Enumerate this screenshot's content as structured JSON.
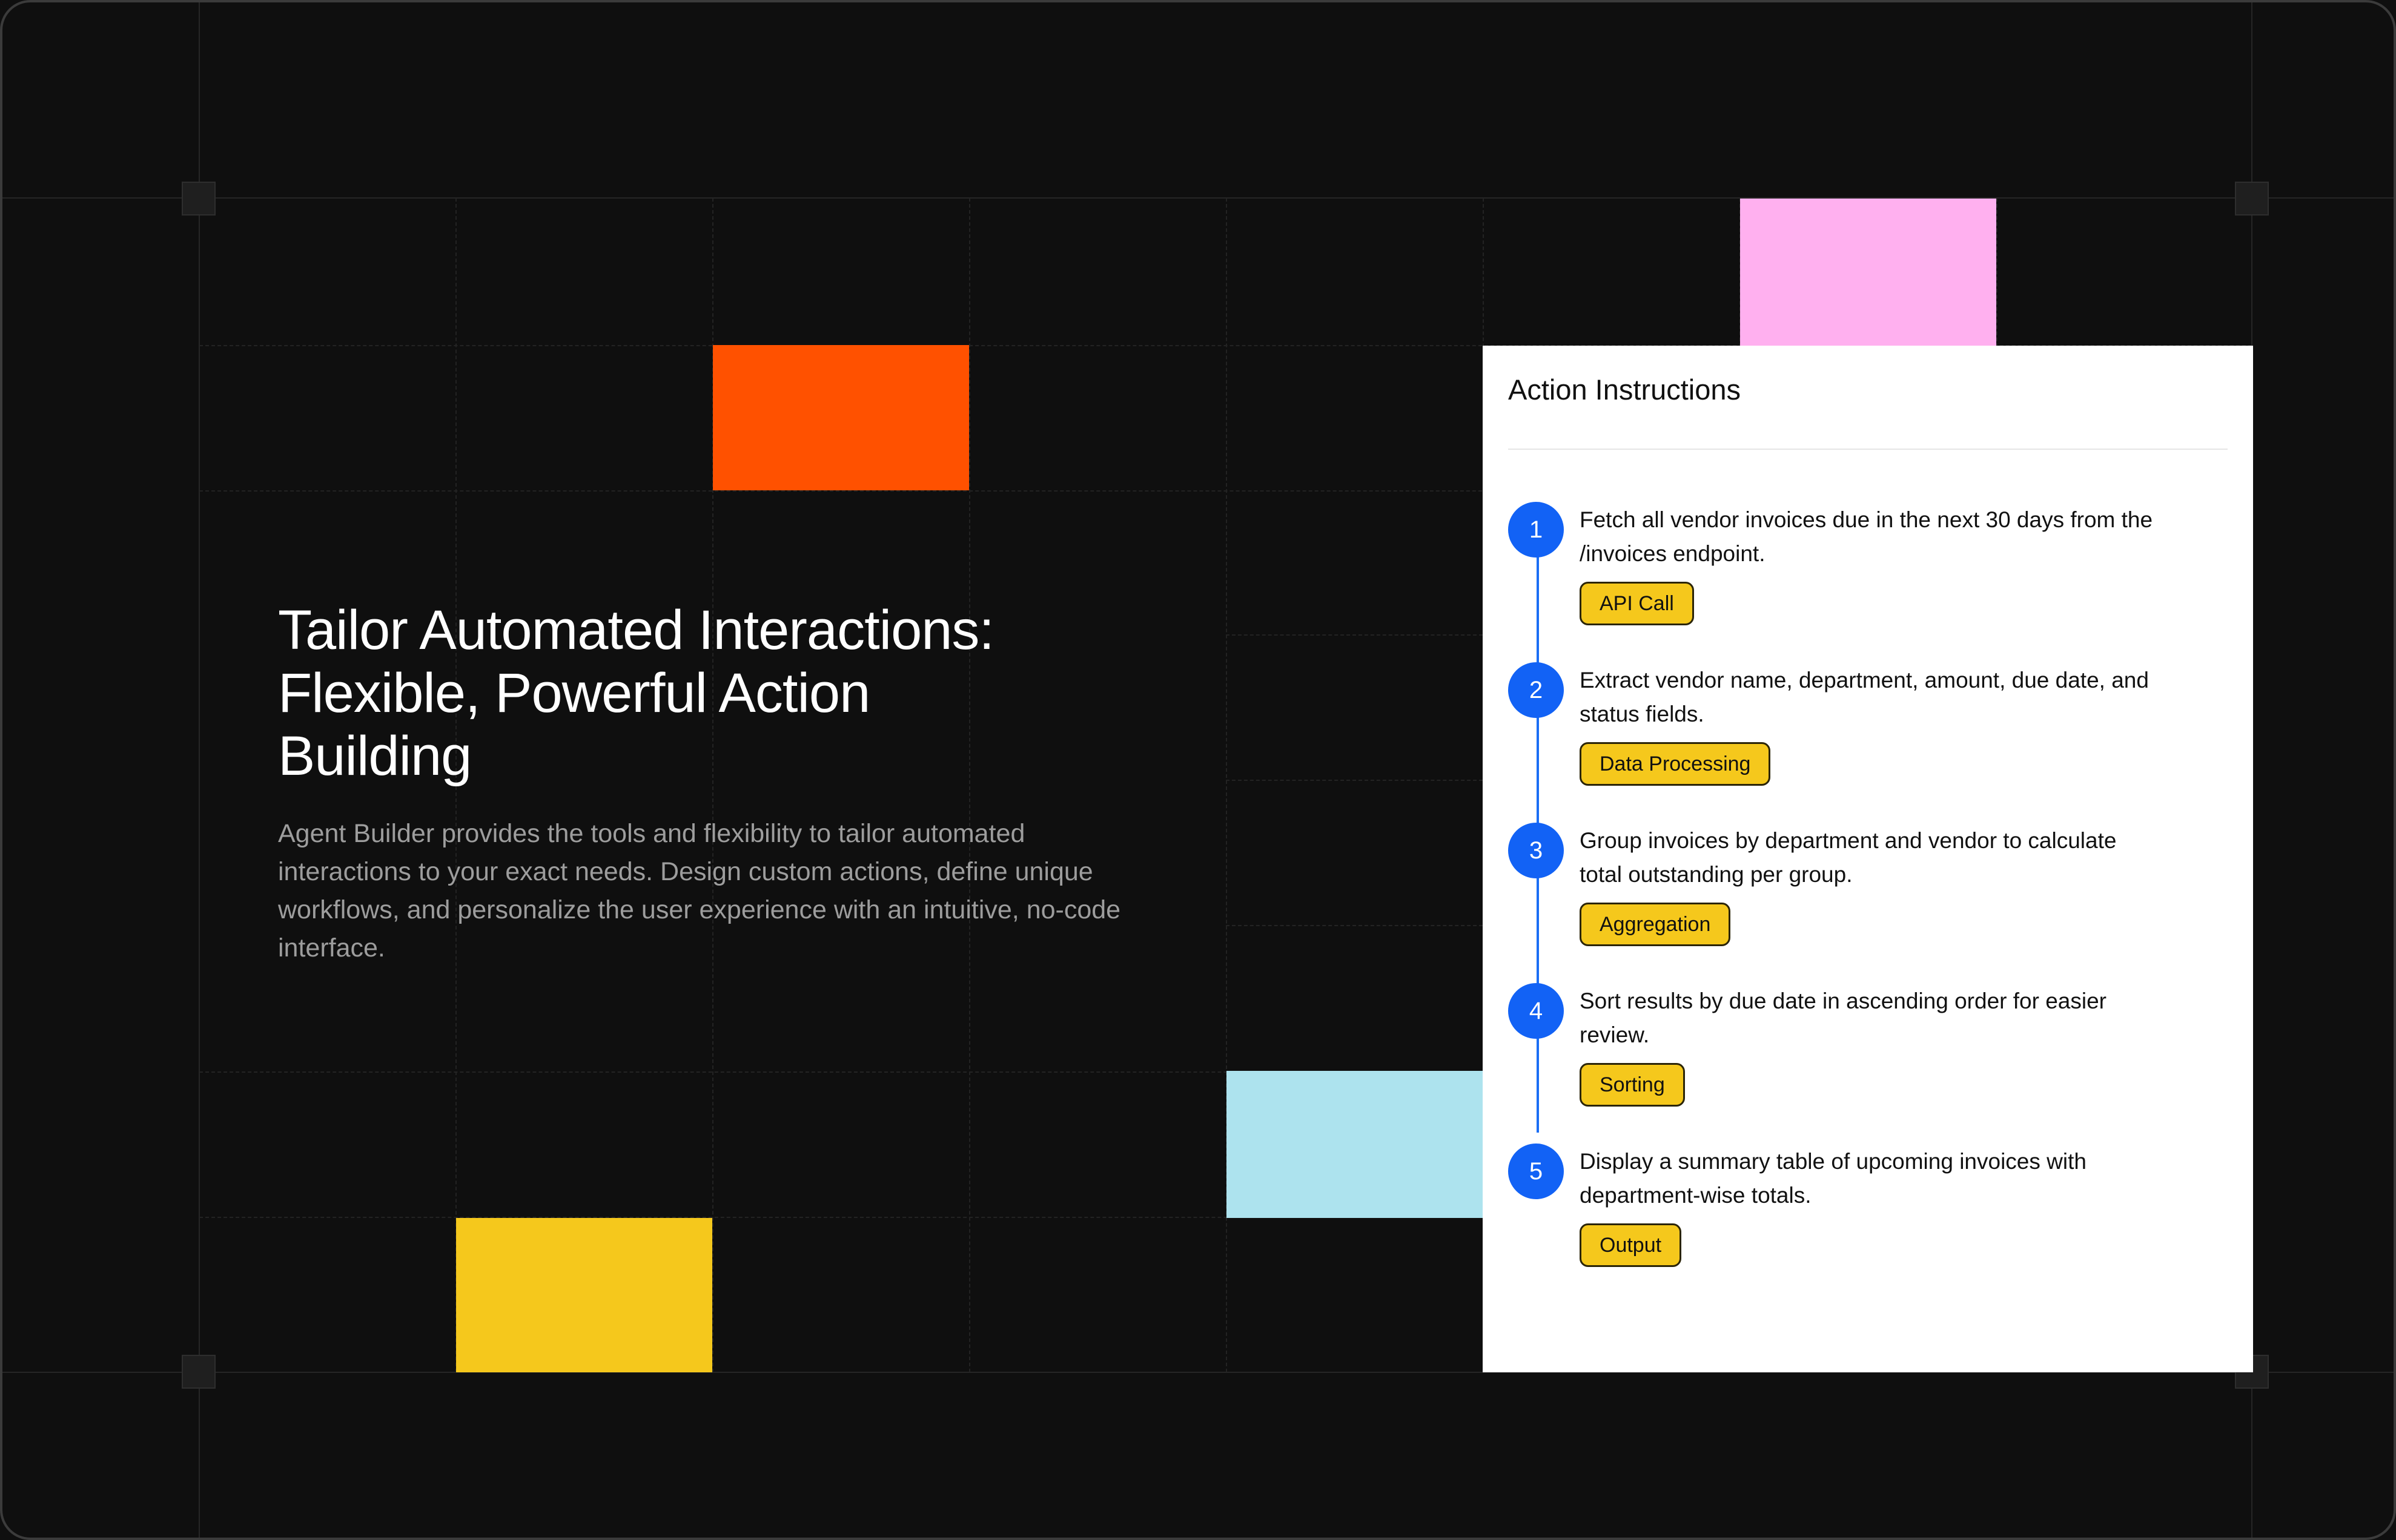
{
  "colors": {
    "background": "#0f0f0f",
    "orange": "#ff5100",
    "pink": "#ffb0ef",
    "light_blue": "#ade3ee",
    "yellow": "#f5c81c",
    "step_blue": "#1262f5",
    "tag_yellow": "#f5c81c"
  },
  "hero": {
    "headline_lines": [
      "Tailor Automated Interactions:",
      "Flexible, Powerful Action",
      "Building"
    ],
    "description_lines": [
      "Agent Builder provides the tools and flexibility to tailor automated",
      "interactions to your exact needs. Design custom actions, define unique",
      "workflows, and personalize the user experience with an intuitive, no-code",
      "interface."
    ]
  },
  "card": {
    "title": "Action Instructions",
    "steps": [
      {
        "number": "1",
        "text_lines": [
          "Fetch all vendor invoices due in the next 30 days from the",
          "/invoices endpoint."
        ],
        "tag": "API Call"
      },
      {
        "number": "2",
        "text_lines": [
          "Extract vendor name, department, amount, due date, and",
          "status fields."
        ],
        "tag": "Data Processing"
      },
      {
        "number": "3",
        "text_lines": [
          "Group invoices by department and vendor to calculate",
          "total outstanding per group."
        ],
        "tag": "Aggregation"
      },
      {
        "number": "4",
        "text_lines": [
          "Sort results by due date in ascending order for easier",
          "review."
        ],
        "tag": "Sorting"
      },
      {
        "number": "5",
        "text_lines": [
          "Display a summary table of upcoming invoices with",
          "department-wise totals."
        ],
        "tag": "Output"
      }
    ]
  }
}
